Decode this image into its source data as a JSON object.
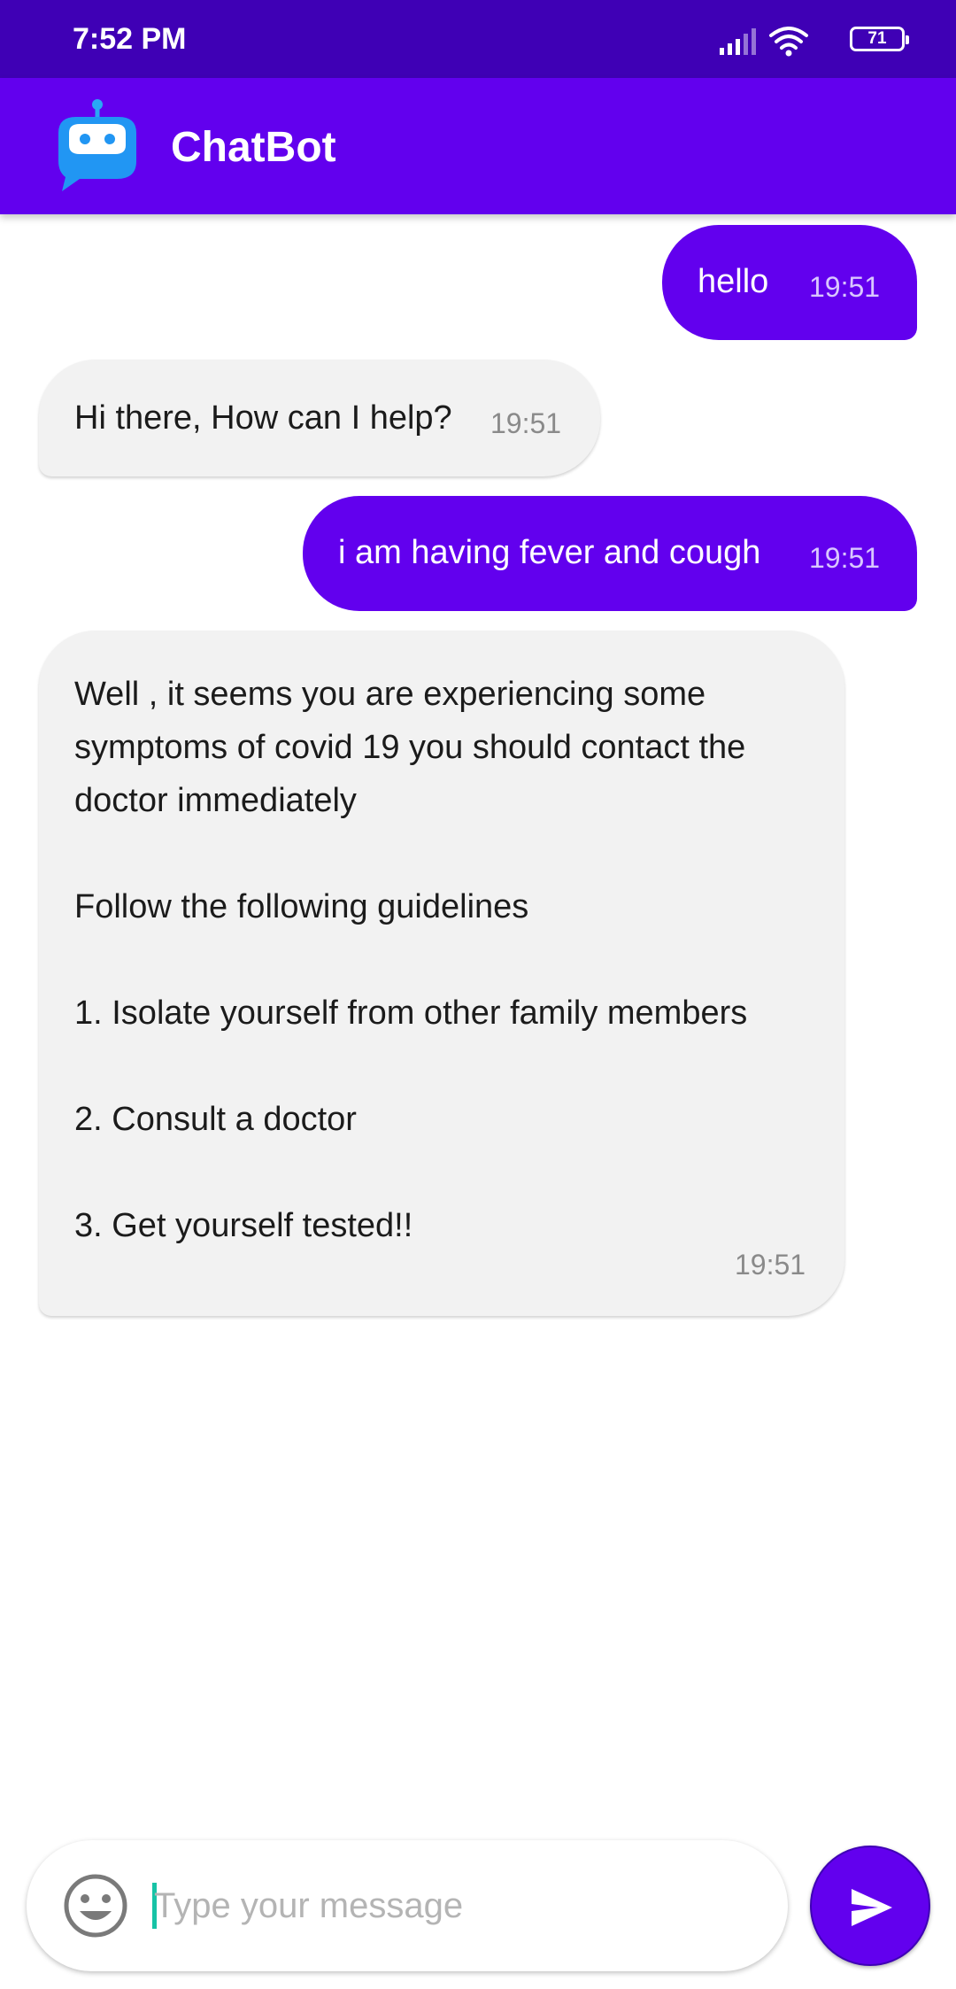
{
  "status_bar": {
    "time": "7:52 PM",
    "battery_level": "71",
    "icons": [
      "signal-icon",
      "wifi-icon",
      "battery-icon"
    ]
  },
  "app_bar": {
    "title": "ChatBot",
    "logo_icon": "robot-chat-icon"
  },
  "messages": [
    {
      "sender": "user",
      "text": "hello",
      "time": "19:51"
    },
    {
      "sender": "bot",
      "text": "Hi there, How can I help?",
      "time": "19:51"
    },
    {
      "sender": "user",
      "text": "i am having fever and cough",
      "time": "19:51"
    },
    {
      "sender": "bot",
      "text": "Well , it seems you are experiencing some symptoms of covid 19 you should contact the doctor immediately\n\n Follow the following guidelines\n\n 1. Isolate yourself from other family members\n\n 2. Consult a doctor\n\n  3. Get yourself tested!!",
      "time": "19:51"
    }
  ],
  "composer": {
    "placeholder": "Type your message",
    "value": "",
    "emoji_icon": "emoji-icon",
    "send_icon": "send-icon"
  },
  "colors": {
    "status_bar": "#3f00b5",
    "primary": "#6200ee",
    "bot_bubble": "#f2f2f2",
    "cursor": "#17c3a6"
  }
}
